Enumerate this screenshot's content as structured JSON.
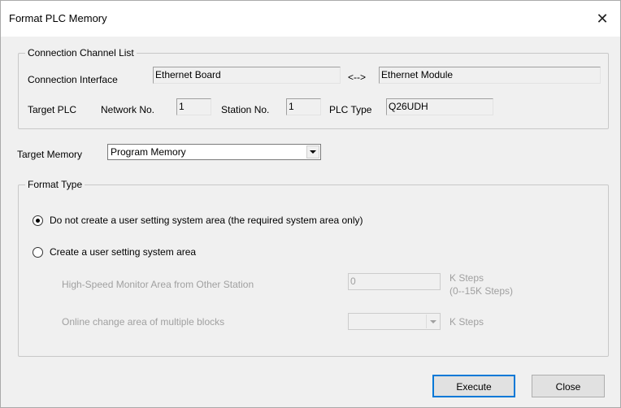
{
  "window": {
    "title": "Format PLC Memory",
    "close_glyph": "✕"
  },
  "connection": {
    "group_title": "Connection Channel List",
    "interface_label": "Connection Interface",
    "interface_value": "Ethernet Board",
    "arrow": "<-->",
    "module_value": "Ethernet Module",
    "target_plc_label": "Target PLC",
    "network_label": "Network No.",
    "network_value": "1",
    "station_label": "Station No.",
    "station_value": "1",
    "plc_type_label": "PLC Type",
    "plc_type_value": "Q26UDH"
  },
  "target_memory": {
    "label": "Target Memory",
    "selected": "Program Memory"
  },
  "format_type": {
    "group_title": "Format Type",
    "option1": "Do not create a user setting system area (the required system area only)",
    "option2": "Create a user setting system area",
    "selected_option": 1,
    "hs_label": "High-Speed Monitor Area from Other Station",
    "hs_value": "0",
    "hs_unit": "K Steps",
    "hs_range": "(0--15K Steps)",
    "online_label": "Online change area of multiple blocks",
    "online_value": "",
    "online_unit": "K Steps"
  },
  "buttons": {
    "execute": "Execute",
    "close": "Close"
  },
  "colors": {
    "focus_border": "#0078d7",
    "dialog_bg": "#f0f0f0",
    "disabled_text": "#a0a0a0"
  }
}
